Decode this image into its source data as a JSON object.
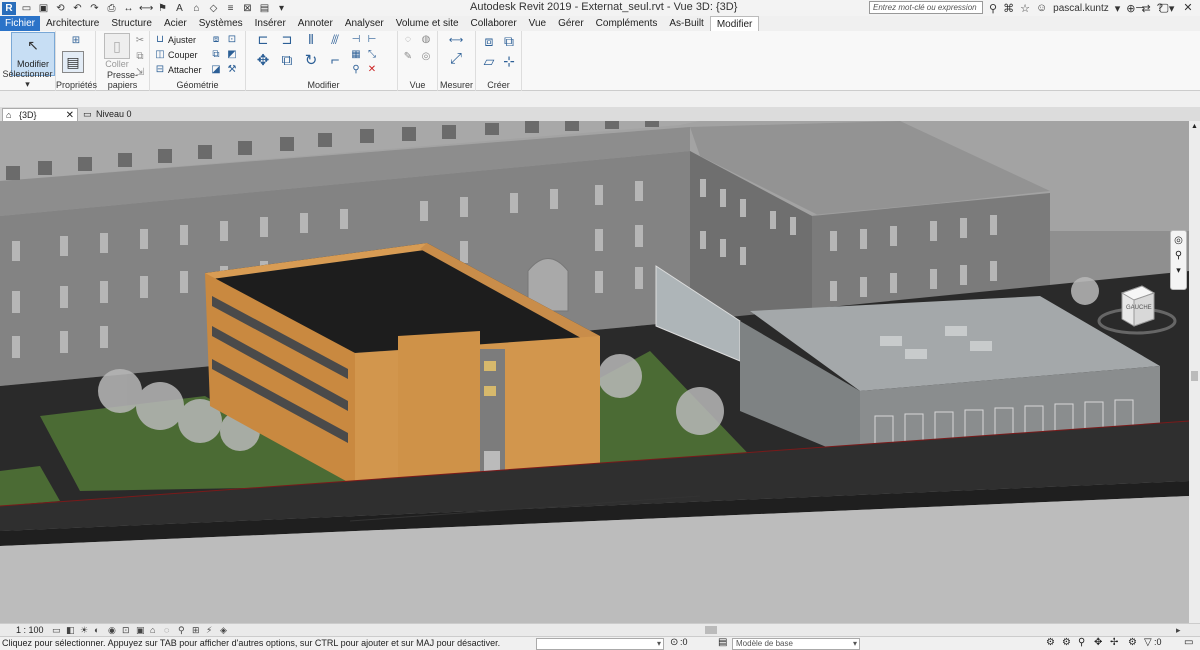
{
  "window": {
    "title": "Autodesk Revit 2019 - Externat_seul.rvt - Vue 3D: {3D}",
    "search_placeholder": "Entrez mot-clé ou expression",
    "user": "pascal.kuntz",
    "logo": "R"
  },
  "menu": {
    "tabs": [
      "Fichier",
      "Architecture",
      "Structure",
      "Acier",
      "Systèmes",
      "Insérer",
      "Annoter",
      "Analyser",
      "Volume et site",
      "Collaborer",
      "Vue",
      "Gérer",
      "Compléments",
      "As-Built",
      "Modifier"
    ],
    "active": "Modifier"
  },
  "ribbon": {
    "modifier_label": "Modifier",
    "coller_label": "Coller",
    "proprietes_label": "Propriétés",
    "ajuster_label": "Ajuster",
    "couper_label": "Couper",
    "attacher_label": "Attacher",
    "panels": {
      "selectionner": "Sélectionner ▾",
      "proprietes": "Propriétés",
      "presse_papiers": "Presse-papiers",
      "geometrie": "Géométrie",
      "modifier": "Modifier",
      "vue": "Vue",
      "mesurer": "Mesurer",
      "creer": "Créer"
    }
  },
  "view_tabs": {
    "tab_3d": "{3D}",
    "tab_niveau": "Niveau 0"
  },
  "viewcube": {
    "face_label": "GAUCHE"
  },
  "view_control": {
    "scale": "1 : 100"
  },
  "status": {
    "text": "Cliquez pour sélectionner. Appuyez sur TAB pour afficher d'autres options, sur CTRL pour ajouter et sur MAJ pour désactiver.",
    "worksets_value": ":0",
    "design_option": "Modèle de base",
    "filter_count": ":0"
  }
}
